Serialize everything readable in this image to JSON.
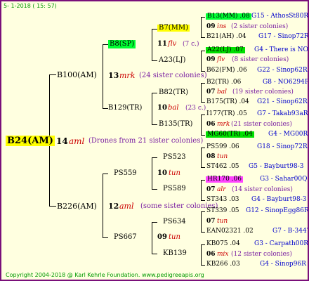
{
  "header": "5-  1-2018  ( 15: 57)",
  "footer": "Copyright 2004-2018 @ Karl Kehrle Foundation.   www.pedigreeapis.org",
  "root": {
    "label": "B24(AM)",
    "num": "14",
    "code": "aml",
    "note": "(Drones from 21 sister colonies)",
    "gen2": {
      "top": {
        "label": "B100(AM)",
        "num": "13",
        "code": "mrk",
        "note": "(24 sister colonies)"
      },
      "bottom": {
        "label": "B226(AM)",
        "num": "12",
        "code": "aml",
        "note": "(some sister colonies)"
      }
    },
    "gen3": {
      "a": {
        "label": "B8(SP)",
        "num": "11",
        "code": "flv",
        "note": "(7 c.)"
      },
      "b": {
        "label": "B129(TR)",
        "num": "10",
        "code": "bal",
        "note": "(23 c.)"
      },
      "c": {
        "label": "PS559",
        "num": "10",
        "code": "tun",
        "note": ""
      },
      "d": {
        "label": "PS667",
        "num": "09",
        "code": "tun",
        "note": ""
      }
    },
    "gen4": [
      {
        "label": "B7(MM)"
      },
      {
        "label": "A23(LJ)"
      },
      {
        "label": "B82(TR)"
      },
      {
        "label": "B135(TR)"
      },
      {
        "label": "PS523"
      },
      {
        "label": "PS589"
      },
      {
        "label": "PS634"
      },
      {
        "label": "KB139"
      }
    ],
    "gen5": [
      {
        "label": "B13(MM) .08",
        "ref": "G15 - AthosSt80R",
        "num": "09",
        "code": "ins",
        "note": "(2 sister colonies)",
        "label2": "B21(AH) .04",
        "ref2": "G17 - Sinop72R"
      },
      {
        "label": "A22(LJ) .07",
        "ref": "G4 - There is NO",
        "num": "09",
        "code": "flv",
        "note": "(8 sister colonies)",
        "label2": "B62(FM) .06",
        "ref2": "G22 - Sinop62R"
      },
      {
        "label": "B2(TR) .06",
        "ref": "G8 - NO6294R",
        "num": "07",
        "code": "bal",
        "note": "(19 sister colonies)",
        "label2": "B175(TR) .04",
        "ref2": "G21 - Sinop62R"
      },
      {
        "label": "I177(TR) .05",
        "ref": "G7 - Takab93aR",
        "num": "06",
        "code": "mrk",
        "note": "(21 sister colonies)",
        "label2": "MG60(TR) .04",
        "ref2": "G4 - MG00R"
      },
      {
        "label": "PS599 .06",
        "ref": "G18 - Sinop72R",
        "num": "08",
        "code": "tun",
        "note": "",
        "label2": "ST462 .05",
        "ref2": "G5 - Bayburt98-3"
      },
      {
        "label": "HR170 .06",
        "ref": "G3 - Sahar00Q",
        "num": "07",
        "code": "alr",
        "note": "(14 sister colonies)",
        "label2": "ST343 .03",
        "ref2": "G4 - Bayburt98-3"
      },
      {
        "label": "ST339 .05",
        "ref": "G12 - SinopEgg86R",
        "num": "07",
        "code": "tun",
        "note": "",
        "label2": "EAN02321 .02",
        "ref2": "G7 - B-344?"
      },
      {
        "label": "KB075 .04",
        "ref": "G3 - Carpath00R",
        "num": "06",
        "code": "mix",
        "note": "(12 sister colonies)",
        "label2": "KB266 .03",
        "ref2": "G4 - Sinop96R"
      }
    ],
    "colors": {
      "frame": "#7a0f7a",
      "background": "#ffffe0",
      "root_highlight": "#ffff00",
      "green_highlight": "#00ff33",
      "magenta_highlight": "#ff44ff",
      "mark_red": "#cc0000",
      "note_purple": "#7a1fa2",
      "ref_blue": "#0000cc"
    }
  }
}
